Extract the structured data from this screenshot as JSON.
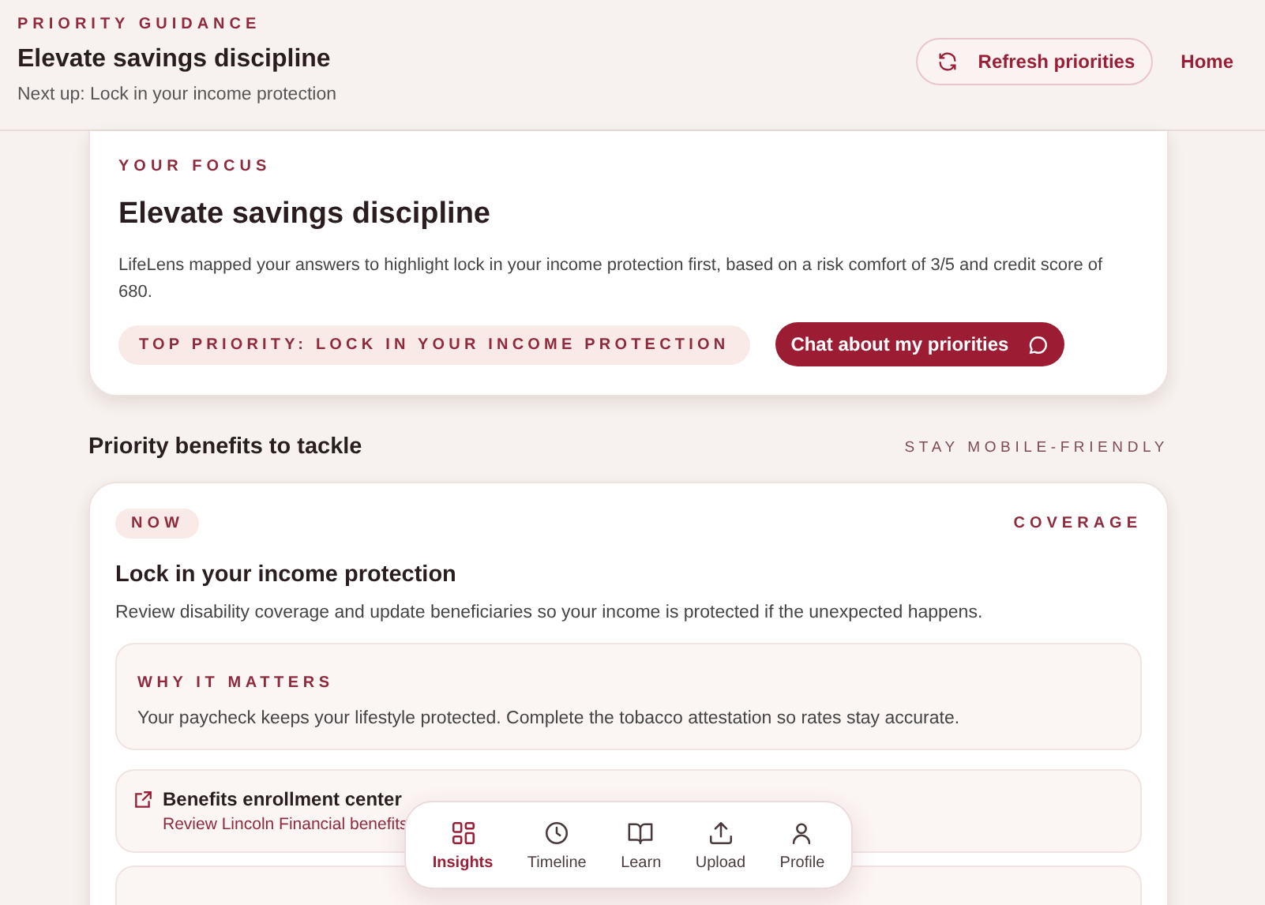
{
  "header": {
    "eyebrow": "PRIORITY GUIDANCE",
    "title": "Elevate savings discipline",
    "subtitle": "Next up: Lock in your income protection",
    "refresh_button": "Refresh priorities",
    "home_link": "Home"
  },
  "focus": {
    "eyebrow": "YOUR FOCUS",
    "title": "Elevate savings discipline",
    "body": "LifeLens mapped your answers to highlight lock in your income protection first, based on a risk comfort of 3/5 and credit score of 680.",
    "priority_badge": "TOP PRIORITY: LOCK IN YOUR INCOME PROTECTION",
    "chat_button": "Chat about my priorities"
  },
  "section": {
    "title": "Priority benefits to tackle",
    "note": "STAY MOBILE-FRIENDLY"
  },
  "benefit": {
    "badge": "NOW",
    "category": "COVERAGE",
    "title": "Lock in your income protection",
    "body": "Review disability coverage and update beneficiaries so your income is protected if the unexpected happens.",
    "why_title": "WHY IT MATTERS",
    "why_body": "Your paycheck keeps your lifestyle protected. Complete the tobacco attestation so rates stay accurate.",
    "link_title": "Benefits enrollment center",
    "link_subtitle": "Review Lincoln Financial benefits"
  },
  "nav": [
    {
      "label": "Insights",
      "kind": "grid",
      "selected": true
    },
    {
      "label": "Timeline",
      "kind": "clock",
      "selected": false
    },
    {
      "label": "Learn",
      "kind": "book",
      "selected": false
    },
    {
      "label": "Upload",
      "kind": "upload",
      "selected": false
    },
    {
      "label": "Profile",
      "kind": "person",
      "selected": false
    }
  ]
}
